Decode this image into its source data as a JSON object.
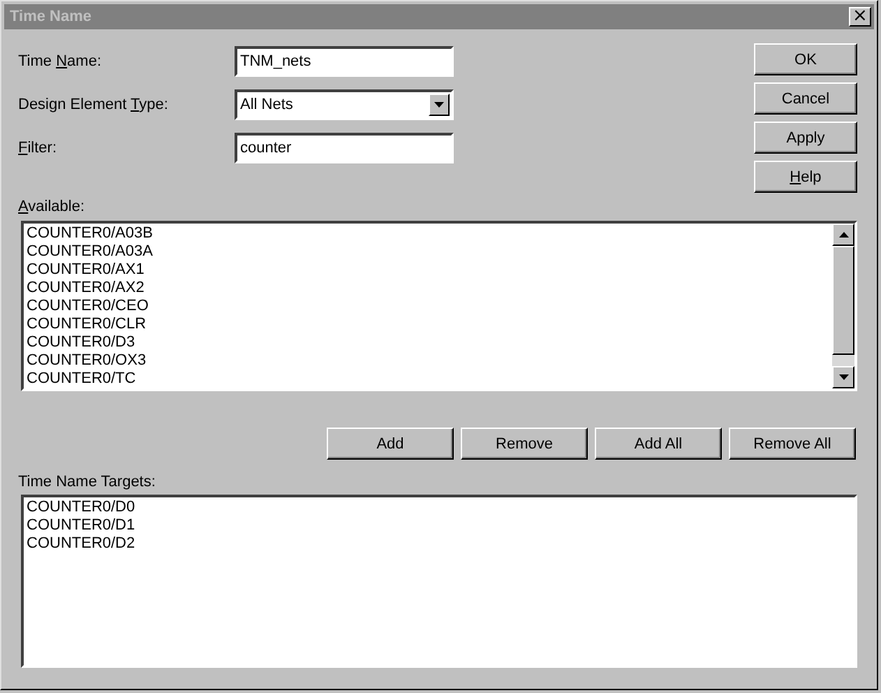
{
  "window": {
    "title": "Time Name",
    "close_glyph": "×"
  },
  "fields": [
    {
      "kind": "text",
      "label": {
        "pre": "Time ",
        "key": "N",
        "post": "ame:"
      },
      "value": "TNM_nets"
    },
    {
      "kind": "dropdown",
      "label": {
        "pre": "Design Element ",
        "key": "T",
        "post": "ype:"
      },
      "value": "All Nets"
    },
    {
      "kind": "text",
      "label": {
        "key": "F",
        "post": "ilter:"
      },
      "value": "counter"
    }
  ],
  "side_buttons": [
    {
      "label": {
        "pre": "OK"
      }
    },
    {
      "label": {
        "pre": "Cancel"
      }
    },
    {
      "label": {
        "pre": "Apply"
      }
    },
    {
      "label": {
        "key": "H",
        "post": "elp"
      }
    }
  ],
  "available": {
    "label": {
      "key": "A",
      "post": "vailable:"
    },
    "items": [
      "COUNTER0/A03B",
      "COUNTER0/A03A",
      "COUNTER0/AX1",
      "COUNTER0/AX2",
      "COUNTER0/CEO",
      "COUNTER0/CLR",
      "COUNTER0/D3",
      "COUNTER0/OX3",
      "COUNTER0/TC"
    ]
  },
  "move_buttons": [
    "Add",
    "Remove",
    "Add All",
    "Remove All"
  ],
  "targets": {
    "label": "Time Name Targets:",
    "items": [
      "COUNTER0/D0",
      "COUNTER0/D1",
      "COUNTER0/D2"
    ]
  }
}
